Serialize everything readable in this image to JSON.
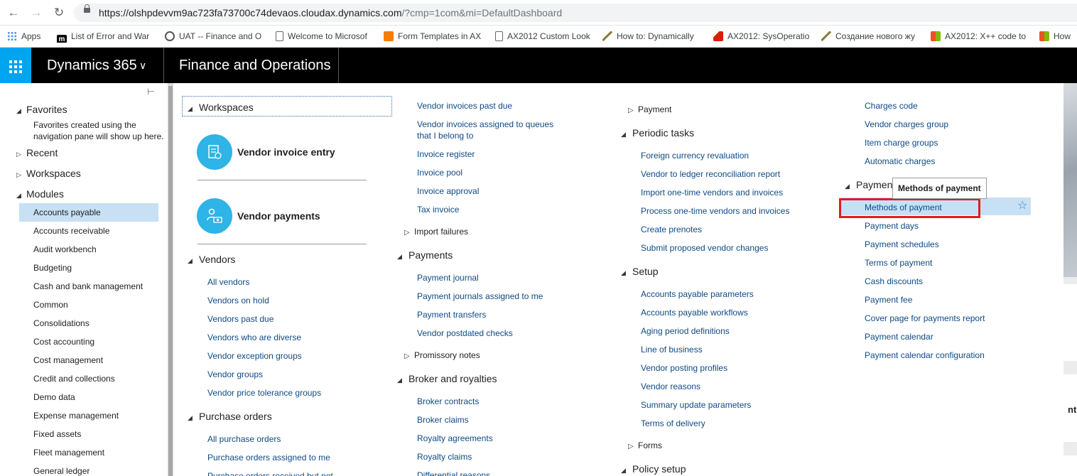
{
  "browser": {
    "url_host": "https://olshpdevvm9ac723fa73700c74devaos.cloudax.dynamics.com",
    "url_rest": "/?cmp=1com&mi=DefaultDashboard",
    "bookmarks": [
      {
        "label": "Apps",
        "icon": "apps-grid-icon",
        "color": "#4285f4"
      },
      {
        "label": "List of Error and War",
        "icon": "m-logo-icon",
        "color": "#000000"
      },
      {
        "label": "UAT -- Finance and O",
        "icon": "gear-group-icon",
        "color": "#555555"
      },
      {
        "label": "Welcome to Microsof",
        "icon": "page-icon",
        "color": "#ffffff"
      },
      {
        "label": "Form Templates in AX",
        "icon": "blogger-icon",
        "color": "#f57d00"
      },
      {
        "label": "AX2012 Custom Look",
        "icon": "page-icon",
        "color": "#ffffff"
      },
      {
        "label": "How to: Dynamically",
        "icon": "chart-icon",
        "color": "#8a7a3a"
      },
      {
        "label": "AX2012: SysOperatio",
        "icon": "red-logo-icon",
        "color": "#d81e05"
      },
      {
        "label": "Создание нового жу",
        "icon": "chart-icon",
        "color": "#8a7a3a"
      },
      {
        "label": "AX2012: X++ code to",
        "icon": "ms-logo-icon",
        "color": "#f25022"
      },
      {
        "label": "How",
        "icon": "ms-logo-icon",
        "color": "#f25022"
      }
    ]
  },
  "header": {
    "brand": "Dynamics 365",
    "product": "Finance and Operations"
  },
  "nav": {
    "favorites": "Favorites",
    "favorites_note": "Favorites created using the navigation pane will show up here.",
    "recent": "Recent",
    "workspaces": "Workspaces",
    "modules": "Modules",
    "module_items": [
      "Accounts payable",
      "Accounts receivable",
      "Audit workbench",
      "Budgeting",
      "Cash and bank management",
      "Common",
      "Consolidations",
      "Cost accounting",
      "Cost management",
      "Credit and collections",
      "Demo data",
      "Expense management",
      "Fixed assets",
      "Fleet management",
      "General ledger"
    ],
    "selected_module": "Accounts payable"
  },
  "col1": {
    "workspaces_head": "Workspaces",
    "tiles": [
      "Vendor invoice entry",
      "Vendor payments"
    ],
    "vendors_head": "Vendors",
    "vendors": [
      "All vendors",
      "Vendors on hold",
      "Vendors past due",
      "Vendors who are diverse",
      "Vendor exception groups",
      "Vendor groups",
      "Vendor price tolerance groups"
    ],
    "po_head": "Purchase orders",
    "po": [
      "All purchase orders",
      "Purchase orders assigned to me",
      "Purchase orders received but not"
    ]
  },
  "col2": {
    "invoices": [
      "Vendor invoices past due",
      "Vendor invoices assigned to queues that I belong to",
      "Invoice register",
      "Invoice pool",
      "Invoice approval",
      "Tax invoice"
    ],
    "import_failures": "Import failures",
    "payments_head": "Payments",
    "payments": [
      "Payment journal",
      "Payment journals assigned to me",
      "Payment transfers",
      "Vendor postdated checks"
    ],
    "promissory": "Promissory notes",
    "broker_head": "Broker and royalties",
    "broker": [
      "Broker contracts",
      "Broker claims",
      "Royalty agreements",
      "Royalty claims",
      "Differential reasons"
    ]
  },
  "col3": {
    "payment": "Payment",
    "periodic_head": "Periodic tasks",
    "periodic": [
      "Foreign currency revaluation",
      "Vendor to ledger reconciliation report",
      "Import one-time vendors and invoices",
      "Process one-time vendors and invoices",
      "Create prenotes",
      "Submit proposed vendor changes"
    ],
    "setup_head": "Setup",
    "setup": [
      "Accounts payable parameters",
      "Accounts payable workflows",
      "Aging period definitions",
      "Line of business",
      "Vendor posting profiles",
      "Vendor reasons",
      "Summary update parameters",
      "Terms of delivery"
    ],
    "forms": "Forms",
    "policy_head": "Policy setup"
  },
  "col4": {
    "charges": [
      "Charges code",
      "Vendor charges group",
      "Item charge groups",
      "Automatic charges"
    ],
    "payment_setup_head": "Paymen",
    "payment_setup": [
      "Methods of payment",
      "Payment days",
      "Payment schedules",
      "Terms of payment",
      "Cash discounts",
      "Payment fee",
      "Cover page for payments report",
      "Payment calendar",
      "Payment calendar configuration"
    ],
    "tooltip": "Methods of payment"
  },
  "background": {
    "peek_text": "nt"
  },
  "colors": {
    "accent": "#00a4ef",
    "link": "#0f4a85",
    "selected": "#c7e0f4",
    "highlight_box": "#e31b23"
  }
}
